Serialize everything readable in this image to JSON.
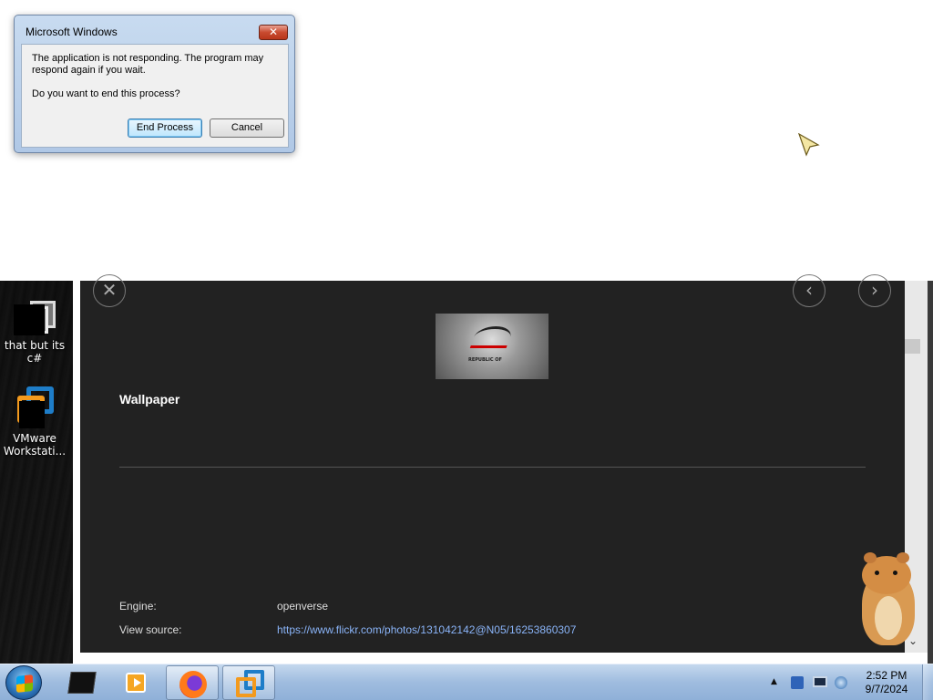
{
  "dialog": {
    "title": "Microsoft Windows",
    "close_glyph": "✕",
    "message": "The application is not responding. The program may respond again if you wait.",
    "question": "Do you want to end this process?",
    "end_process_label": "End Process",
    "cancel_label": "Cancel"
  },
  "desktop": {
    "icons": [
      {
        "label": "that but its c#",
        "icon": "copy-icon"
      },
      {
        "label": "VMware Workstati...",
        "icon": "vmware-icon"
      }
    ]
  },
  "viewer": {
    "close_glyph": "✕",
    "prev_glyph": "‹",
    "next_glyph": "›",
    "thumbnail_text": "REPUBLIC OF",
    "title": "Wallpaper",
    "engine_label": "Engine:",
    "engine_value": "openverse",
    "source_label": "View source:",
    "source_value": "https://www.flickr.com/photos/131042142@N05/16253860307",
    "scroll_down_glyph": "⌄"
  },
  "taskbar": {
    "items": [
      "black-window-icon",
      "media-player-icon",
      "firefox-icon",
      "vmware-icon"
    ],
    "active_index": 2,
    "tray_arrow": "▲",
    "time": "2:52 PM",
    "date": "9/7/2024"
  },
  "colors": {
    "viewer_bg": "#222222",
    "link": "#8ab4f8",
    "taskbar": "#9fbcdf",
    "dialog_frame": "#b0c8e6"
  }
}
